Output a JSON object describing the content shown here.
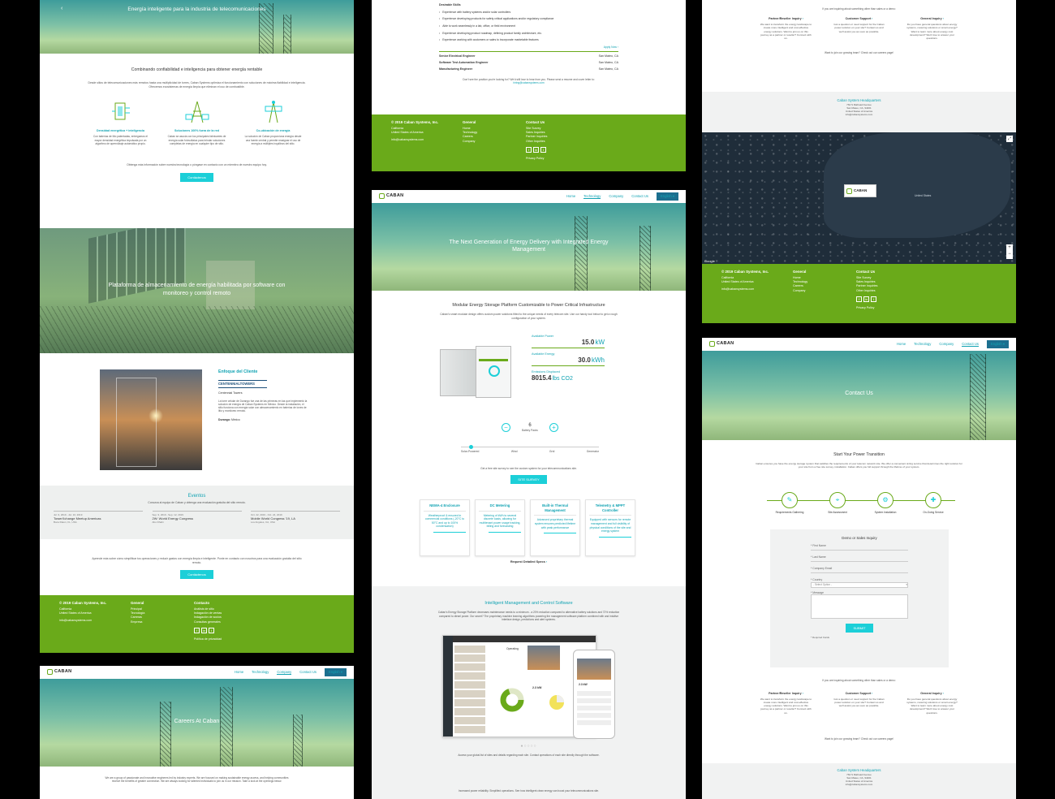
{
  "colors": {
    "accent_green": "#6aaa1a",
    "teal": "#12a3b3",
    "button_cyan": "#1ccfd8",
    "map_dark": "#1f2d3a"
  },
  "nav": {
    "brand": "CABAN",
    "brand_sub": "SYSTEMS",
    "items": [
      "Home",
      "Technology",
      "Company",
      "Contact Us"
    ],
    "lang": "English"
  },
  "es_page": {
    "hero_title": "Energía inteligente para la industria de telecomunicaciones",
    "intro_title": "Combinando confiabilidad e inteligencia para obtener energía rentable",
    "intro_text": "Desde sitios de telecomunicaciones más remotos hasta una multiplicidad de torres, Caban Systems optimiza el funcionamiento con soluciones de máxima fiabilidad e inteligencia. Ofrecemos ecosistemas de energía limpia que eliminan el uso de combustible.",
    "features": [
      {
        "title": "Densidad energética + inteligencia",
        "text": "Con baterías de litio patentadas, entregamos el mayor densidad energética impulsada por un algoritmo de aprendizaje automático propio."
      },
      {
        "title": "Soluciones 100% fuera de la red",
        "text": "Caban se asocia con los principales fabricantes de energía solar fotovoltaica para brindar soluciones completas de energía en cualquier tipo de sitio."
      },
      {
        "title": "Co-ubicación de energía",
        "text": "La solución de Caban proporciona energía desde una fuente central y permite reasignar el uso de energía a múltiples inquilinos del sitio."
      }
    ],
    "more_text": "Obtenga más información sobre nuestra tecnología o póngase en contacto con un miembro de nuestro equipo hoy.",
    "contact_btn": "Contáctenos",
    "platform_title": "Plataforma de almacenamiento de energía habilitada por software con monitoreo y control remoto",
    "client_focus": "Enfoque del Cliente",
    "client_logo": "CENTENNIALTOWERS",
    "client_name": "Centennial Towers",
    "client_text": "La torre celular de Durango fue una de las primeras en las que implementó la solución de energía de Caban Systems en México. Desde la instalación, el sitio funciona con energía solar con almacenamiento en baterías de iones de litio y monitoreo remoto.",
    "client_location_label": "Durango:",
    "client_location": "México",
    "events_title": "Eventos",
    "events_sub": "Conozca al equipo de Caban y obtenga una evaluación gratuita del sitio remoto.",
    "events": [
      {
        "date": "Jul. 9, 2019 - Jul. 10, 2019",
        "name": "TowerXchange Meetup Americas",
        "place": "Boca Raton, FL, USA"
      },
      {
        "date": "Sep. 9, 2019 - Sep. 12, 2019",
        "name": "2W: World Energy Congress",
        "place": "Abu Dhabi"
      },
      {
        "date": "Oct. 22, 2019 - Oct. 24, 2019",
        "name": "Mobile World Congress '19, LA",
        "place": "Los Angeles, CA, USA"
      }
    ],
    "cta_text": "Aprende más sobre cómo simplificar tus operaciones y reducir gastos con energía limpia e inteligente. Ponte en contacto con nosotros para una evaluación gratuita del sitio remoto.",
    "cta_btn": "Contáctenos",
    "footer": {
      "copy": "© 2019 Caban Systems, Inc.",
      "addr1": "California",
      "addr2": "United States of America",
      "email": "info@cabansystems.com",
      "col1_title": "General",
      "col1": [
        "Principal",
        "Tecnología",
        "Carreras",
        "Empresa"
      ],
      "col2_title": "Contacto",
      "col2": [
        "Análisis de sitio",
        "Indagación de ventas",
        "Indagación de socios",
        "Consultas generales"
      ],
      "privacy": "Política de privacidad"
    }
  },
  "careers_page": {
    "title": "Careers At Caban",
    "text": "We are a group of passionate and innovative engineers led by industry experts. We are focused on making sustainable energy access, and helping communities receive the benefits of greater connection. We are always looking for talented individuals to join us in our mission. Take a look at the openings below.",
    "desirable": "Desirable Skills",
    "skills": [
      "Experience with battery systems and/or solar controllers",
      "Experience developing products for safety critical applications and/or regulatory compliance",
      "Able to work seamlessly in a lab, office, or field environment",
      "Experience developing product roadmap, defining product family architecture, etc.",
      "Experience working with customers or sales to incorporate marketable features"
    ],
    "apply": "Apply Now",
    "jobs": [
      {
        "title": "Senior Electrical Engineer",
        "loc": "San Mateo, CA"
      },
      {
        "title": "Software Test Automation Engineer",
        "loc": "San Mateo, CA"
      },
      {
        "title": "Manufacturing Engineer",
        "loc": "San Mateo, CA"
      }
    ],
    "not_found": "Don't see the position you're looking for? We'd still love to hear from you. Please send a resume and cover letter to:",
    "hiring_email": "hiring@cabansystems.com",
    "footer": {
      "copy": "© 2019 Caban Systems, Inc.",
      "addr1": "California",
      "addr2": "United States of America",
      "email": "info@cabansystems.com",
      "col1_title": "General",
      "col1": [
        "Home",
        "Technology",
        "Careers",
        "Company"
      ],
      "col2_title": "Contact Us",
      "col2": [
        "Site Survey",
        "Sales Inquiries",
        "Partner Inquiries",
        "Other Inquiries"
      ],
      "privacy": "Privacy Policy"
    }
  },
  "tech_page": {
    "hero_title": "The Next Generation of Energy Delivery with Integrated Energy Management",
    "section_title": "Modular Energy Storage Platform Customizable to Power Critical Infrastructure",
    "section_text": "Caban's smart modular design offers custom power solutions fitted to the unique needs of every telecom site. Use our handy tool below to get a rough configuration of your system.",
    "stats": [
      {
        "label": "Available Power",
        "value": "15.0",
        "unit": "kW"
      },
      {
        "label": "Available Energy",
        "value": "30.0",
        "unit": "kWh"
      },
      {
        "label": "Emissions Displaced",
        "value": "8015.4",
        "unit": "lbs CO2"
      }
    ],
    "battery_count": "6",
    "battery_label": "Battery Packs",
    "sources": [
      "Solar-Powered",
      "Wind",
      "Grid",
      "Generator"
    ],
    "survey_text": "Get a free site survey to see the custom system for your telecommunications site.",
    "survey_btn": "SITE SURVEY",
    "cards": [
      {
        "title": "NEMA-4 Enclosure",
        "text": "Weatherproof & ensured in commercial conditions (-20°C to 50°C and up to 100% condensation)"
      },
      {
        "title": "DC Metering",
        "text": "Metering of kWh to several discrete loads, allowing for multitenant power usage tracking, billing and forecasting"
      },
      {
        "title": "Built-in Thermal Management",
        "text": "Advanced proprietary thermal system ensures predicted lifetime with peak performance"
      },
      {
        "title": "Telemetry & MPPT Controller",
        "text": "Equipped with sensors for remote management and full visibility of physical conditions of the site and energy system"
      }
    ],
    "spec_link": "Request Detailed Specs",
    "software_title": "Intelligent Management and Control Software",
    "software_text": "Caban's Energy Storage Platform decreases maintenance needs to a minimum - a 20% reduction compared to alternative battery solutions and 72% reduction compared to diesel power. Our secret? The proprietary machine learning algorithms powering the management software platform combined with and intuitive interface design, predictions and alert systems.",
    "dash_labels": [
      "Operating",
      "2.3 kW",
      "2.3 kW"
    ],
    "access_text": "Access your global list of sites and details regarding each site. Contact operations of each site directly through the software.",
    "bottom_text": "Increased power reliability. Simplified operations. See how intelligent clean energy can boost your telecommunications site."
  },
  "map_page": {
    "inquiry_intro": "If you are inquiring about something other than sales or a demo:",
    "inquiries": [
      {
        "title": "Partner/Reseller Inquiry",
        "text": "We want to transform the energy landscape to create more intelligent and cost-effective energy solutions. Want to join us on this journey as a partner or reseller? Connect with us."
      },
      {
        "title": "Customer Support",
        "text": "Got a question or need support for the Caban power solution on your site? Contact us and we'll assist you as soon as possible."
      },
      {
        "title": "General Inquiry",
        "text": "Do you have general questions about energy systems, metering solutions or smart energy? Want to learn more about energy cost development? We'd love to answer your questions."
      }
    ],
    "join_text": "Want to join our growing team? Check out our careers page!",
    "hq_title": "Caban System Headquarters",
    "hq_lines": [
      "764 S Railroad Avenue",
      "San Mateo, CA, 94401",
      "United States of America",
      "info@cabansystems.com"
    ],
    "map_label": "United States",
    "google": "Google",
    "footer": {
      "copy": "© 2019 Caban Systems, Inc.",
      "addr1": "California",
      "addr2": "United States of America",
      "email": "info@cabansystems.com",
      "col1_title": "General",
      "col1": [
        "Home",
        "Technology",
        "Careers",
        "Company"
      ],
      "col2_title": "Contact Us",
      "col2": [
        "Site Survey",
        "Sales Inquiries",
        "Partner Inquiries",
        "Other Inquiries"
      ],
      "privacy": "Privacy Policy"
    }
  },
  "contact_page": {
    "hero_title": "Contact Us",
    "section_title": "Start Your Power Transition",
    "section_text": "Caban ensures you have the energy storage system that satisfies the requirements of your telecom network site. We offer a convenient sizing service that determines the right solution for your site from a free site survey, installation. Caban offers you full support through the lifetime of your system.",
    "steps": [
      "Requirements Gathering",
      "Site Assessment",
      "System Installation",
      "On-Going Service"
    ],
    "form_title": "Demo or Sales Inquiry",
    "fields": [
      "* First Name",
      "* Last Name",
      "* Company Email",
      "* Country",
      "* Message"
    ],
    "country_placeholder": "- Select Option -",
    "submit": "SUBMIT",
    "required": "* Required Fields",
    "inquiry_intro": "If you are inquiring about something other than sales or a demo:",
    "inquiries": [
      {
        "title": "Partner/Reseller Inquiry",
        "text": "We want to transform the energy landscape to create more intelligent and cost-effective energy solutions. Want to join us on this journey as a partner or reseller? Connect with us."
      },
      {
        "title": "Customer Support",
        "text": "Got a question or need support for the Caban power solution on your site? Contact us and we'll assist you as soon as possible."
      },
      {
        "title": "General Inquiry",
        "text": "Do you have general questions about energy systems, metering solutions or smart energy? Want to learn more about energy cost development? We'd love to answer your questions."
      }
    ],
    "join_text": "Want to join our growing team? Check out our careers page!",
    "hq_title": "Caban System Headquarters",
    "hq_lines": [
      "764 S Railroad Avenue",
      "San Mateo, CA, 94401",
      "United States of America",
      "info@cabansystems.com"
    ]
  }
}
